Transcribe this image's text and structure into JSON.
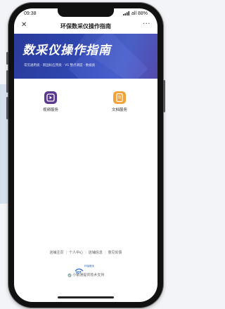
{
  "status": {
    "time": "09:38",
    "signal": "all",
    "battery": "88%"
  },
  "navbar": {
    "title": "环保数采仪操作指南",
    "more": "···"
  },
  "banner": {
    "title": "数采仪操作指南",
    "subtitle": "常见通用类 · 新国标应用类 · VS 整点调度 · 数据类"
  },
  "services": [
    {
      "label": "视频服务",
      "icon": "play-icon",
      "color": "#5b3a8e"
    },
    {
      "label": "文档服务",
      "icon": "document-icon",
      "color": "#f2a23a"
    }
  ],
  "footer": {
    "links": [
      "店铺主页",
      "个人中心",
      "店铺信息",
      "意见反馈"
    ],
    "logo_text": "环保数采",
    "support": "小鹅通提供技术支持"
  }
}
